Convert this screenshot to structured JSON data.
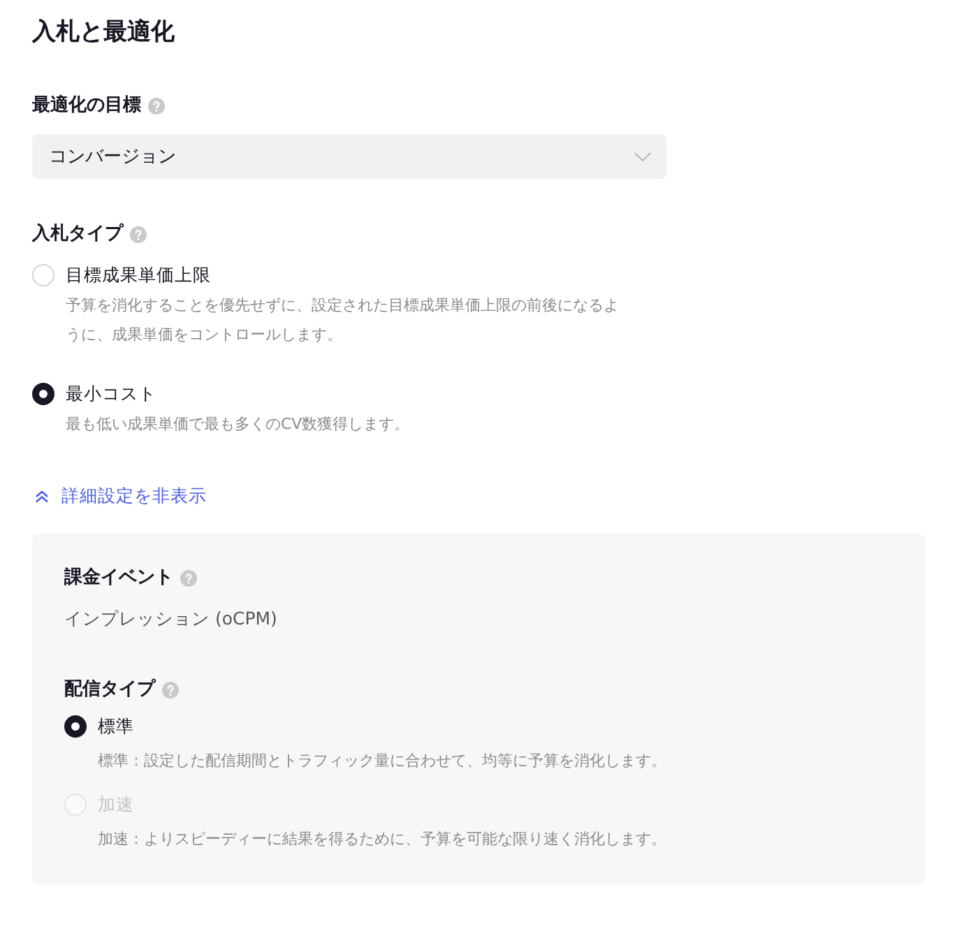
{
  "title": "入札と最適化",
  "optimization_goal": {
    "label": "最適化の目標",
    "value": "コンバージョン"
  },
  "bid_type": {
    "label": "入札タイプ",
    "options": [
      {
        "label": "目標成果単価上限",
        "description": "予算を消化することを優先せずに、設定された目標成果単価上限の前後になるように、成果単価をコントロールします。",
        "selected": false
      },
      {
        "label": "最小コスト",
        "description": "最も低い成果単価で最も多くのCV数獲得します。",
        "selected": true
      }
    ]
  },
  "advanced_toggle": {
    "label": "詳細設定を非表示",
    "expanded": true
  },
  "advanced": {
    "billing_event": {
      "label": "課金イベント",
      "value": "インプレッション (oCPM)"
    },
    "delivery_type": {
      "label": "配信タイプ",
      "options": [
        {
          "label": "標準",
          "description": "標準：設定した配信期間とトラフィック量に合わせて、均等に予算を消化します。",
          "selected": true,
          "disabled": false
        },
        {
          "label": "加速",
          "description": "加速：よりスピーディーに結果を得るために、予算を可能な限り速く消化します。",
          "selected": false,
          "disabled": true
        }
      ]
    }
  }
}
